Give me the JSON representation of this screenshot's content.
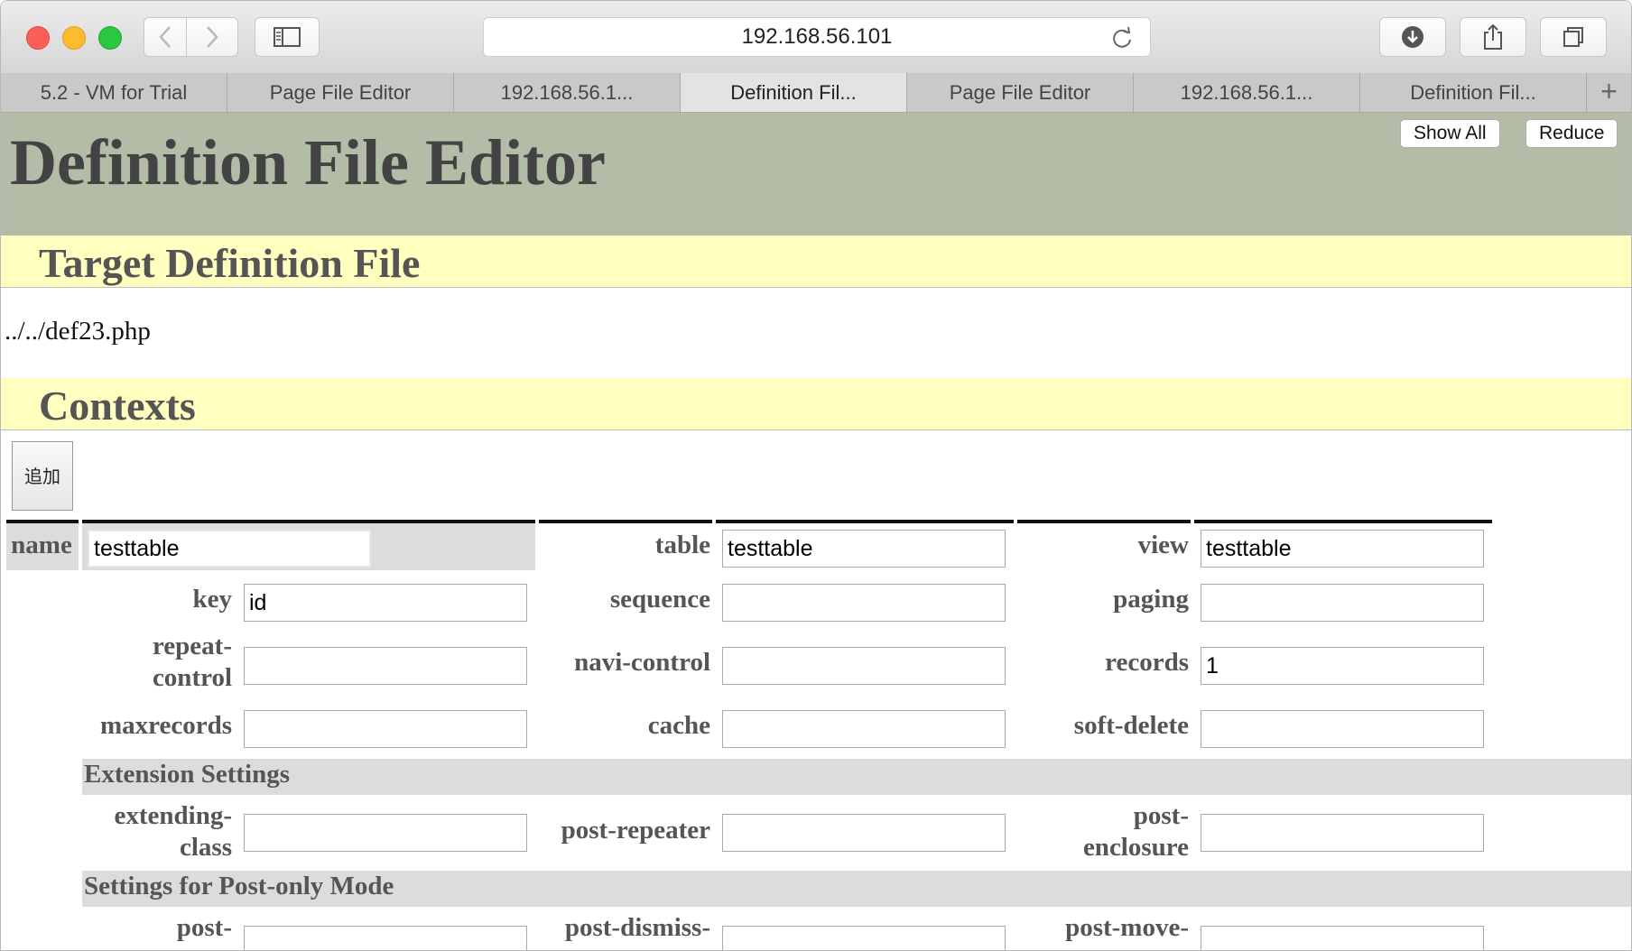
{
  "browser": {
    "url": "192.168.56.101",
    "tabs": [
      {
        "label": "5.2 - VM for Trial",
        "active": false
      },
      {
        "label": "Page File Editor",
        "active": false
      },
      {
        "label": "192.168.56.1...",
        "active": false
      },
      {
        "label": "Definition Fil...",
        "active": true
      },
      {
        "label": "Page File Editor",
        "active": false
      },
      {
        "label": "192.168.56.1...",
        "active": false
      },
      {
        "label": "Definition Fil...",
        "active": false
      }
    ],
    "new_tab_label": "+"
  },
  "page": {
    "title": "Definition File Editor",
    "show_all_label": "Show All",
    "reduce_label": "Reduce",
    "target_heading": "Target Definition File",
    "target_path": "../../def23.php",
    "contexts_heading": "Contexts",
    "add_button_label": "追加"
  },
  "context": {
    "name_label": "name",
    "name_value": "testtable",
    "table_label": "table",
    "table_value": "testtable",
    "view_label": "view",
    "view_value": "testtable",
    "key_label": "key",
    "key_value": "id",
    "sequence_label": "sequence",
    "sequence_value": "",
    "paging_label": "paging",
    "paging_value": "",
    "repeat_control_label": "repeat-control",
    "repeat_control_value": "",
    "navi_control_label": "navi-control",
    "navi_control_value": "",
    "records_label": "records",
    "records_value": "1",
    "maxrecords_label": "maxrecords",
    "maxrecords_value": "",
    "cache_label": "cache",
    "cache_value": "",
    "soft_delete_label": "soft-delete",
    "soft_delete_value": "",
    "extension_heading": "Extension Settings",
    "extending_class_label": "extending-class",
    "extending_class_value": "",
    "post_repeater_label": "post-repeater",
    "post_repeater_value": "",
    "post_enclosure_label": "post-enclosure",
    "post_enclosure_value": "",
    "post_only_heading": "Settings for Post-only Mode",
    "post_label": "post-",
    "post_dismiss_label": "post-dismiss-",
    "post_move_label": "post-move-"
  }
}
